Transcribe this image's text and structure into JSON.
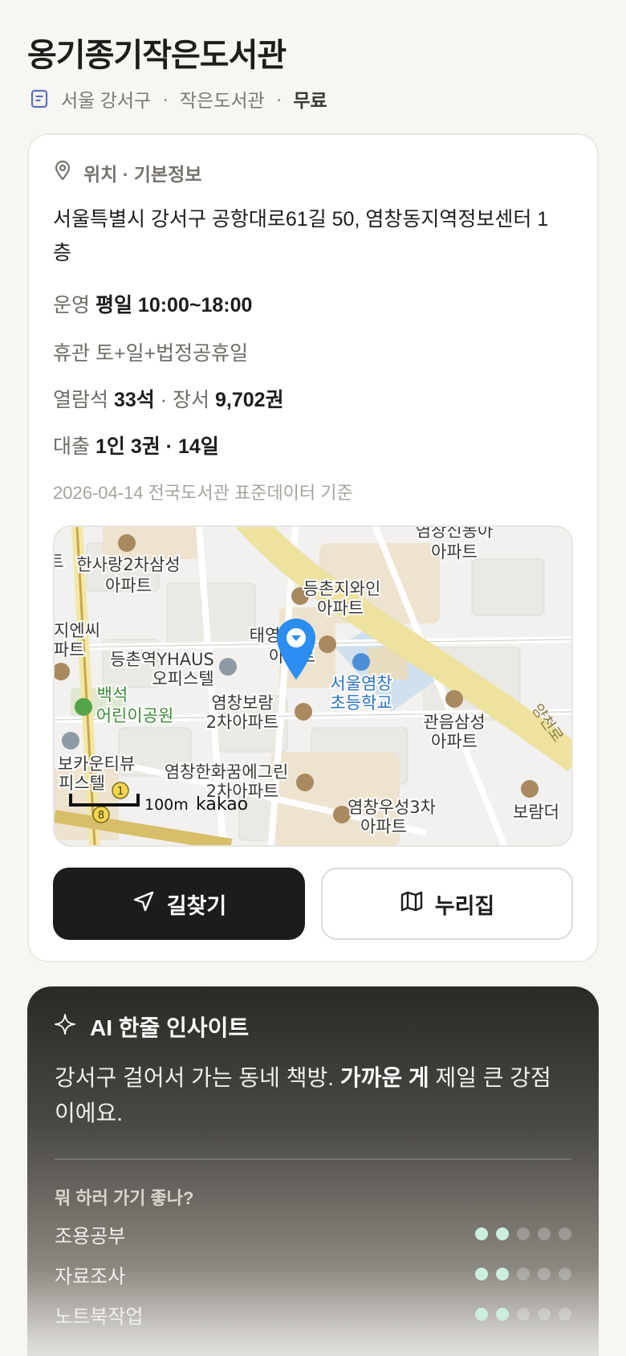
{
  "library": {
    "name": "옹기종기작은도서관",
    "region": "서울 강서구",
    "type": "작은도서관",
    "fee": "무료"
  },
  "info": {
    "section_title": "위치 · 기본정보",
    "address": "서울특별시 강서구 공항대로61길 50, 염창동지역정보센터 1층",
    "hours_label": "운영",
    "hours_value": "평일 10:00~18:00",
    "closed_label": "휴관",
    "closed_value": "토+일+법정공휴일",
    "seats_label": "열람석",
    "seats_value": "33석",
    "books_label": "장서",
    "books_value": "9,702권",
    "loan_label": "대출",
    "loan_value": "1인 3권 · 14일",
    "data_date": "2026-04-14 전국도서관 표준데이터 기준"
  },
  "map": {
    "labels": {
      "apt1a": "한사랑2차삼성",
      "apt1b": "아파트",
      "apt2a": "등촌지와인",
      "apt2b": "아파트",
      "apt3a": "염창신동아",
      "apt3b": "아파트",
      "edge1a": "지엔씨",
      "edge1b": "파트",
      "office1a": "등촌역YHAUS",
      "office1b": "오피스텔",
      "apt4a": "태영",
      "apt4b": "아파트",
      "park1": "백석",
      "park2": "어린이공원",
      "school1": "서울염창",
      "school2": "초등학교",
      "apt5a": "염창보람",
      "apt5b": "2차아파트",
      "apt6a": "관음삼성",
      "apt6b": "아파트",
      "office2a": "보카운티뷰",
      "office2b": "피스텔",
      "apt7a": "염창한화꿈에그린",
      "apt7b": "2차아파트",
      "apt8a": "염창우성3차",
      "apt8b": "아파트",
      "edge2": "보람더",
      "road": "양천로",
      "edge3": "트",
      "scale": "100m",
      "provider": "kakao",
      "badge1": "1",
      "badge8": "8"
    }
  },
  "buttons": {
    "directions": "길찾기",
    "website": "누리집"
  },
  "ai": {
    "title": "AI 한줄 인사이트",
    "text_before": "강서구 걸어서 가는 동네 책방.",
    "text_bold": "가까운 게",
    "text_after": "제일 큰 강점이에요.",
    "question": "뭐 하러 가기 좋나?",
    "activities": [
      {
        "label": "조용공부",
        "score": 2,
        "max": 5
      },
      {
        "label": "자료조사",
        "score": 2,
        "max": 5
      },
      {
        "label": "노트북작업",
        "score": 2,
        "max": 5
      }
    ]
  },
  "colors": {
    "accent_blue": "#2b8ef0",
    "dark": "#1d1c1a",
    "mint": "#cbeee0"
  }
}
